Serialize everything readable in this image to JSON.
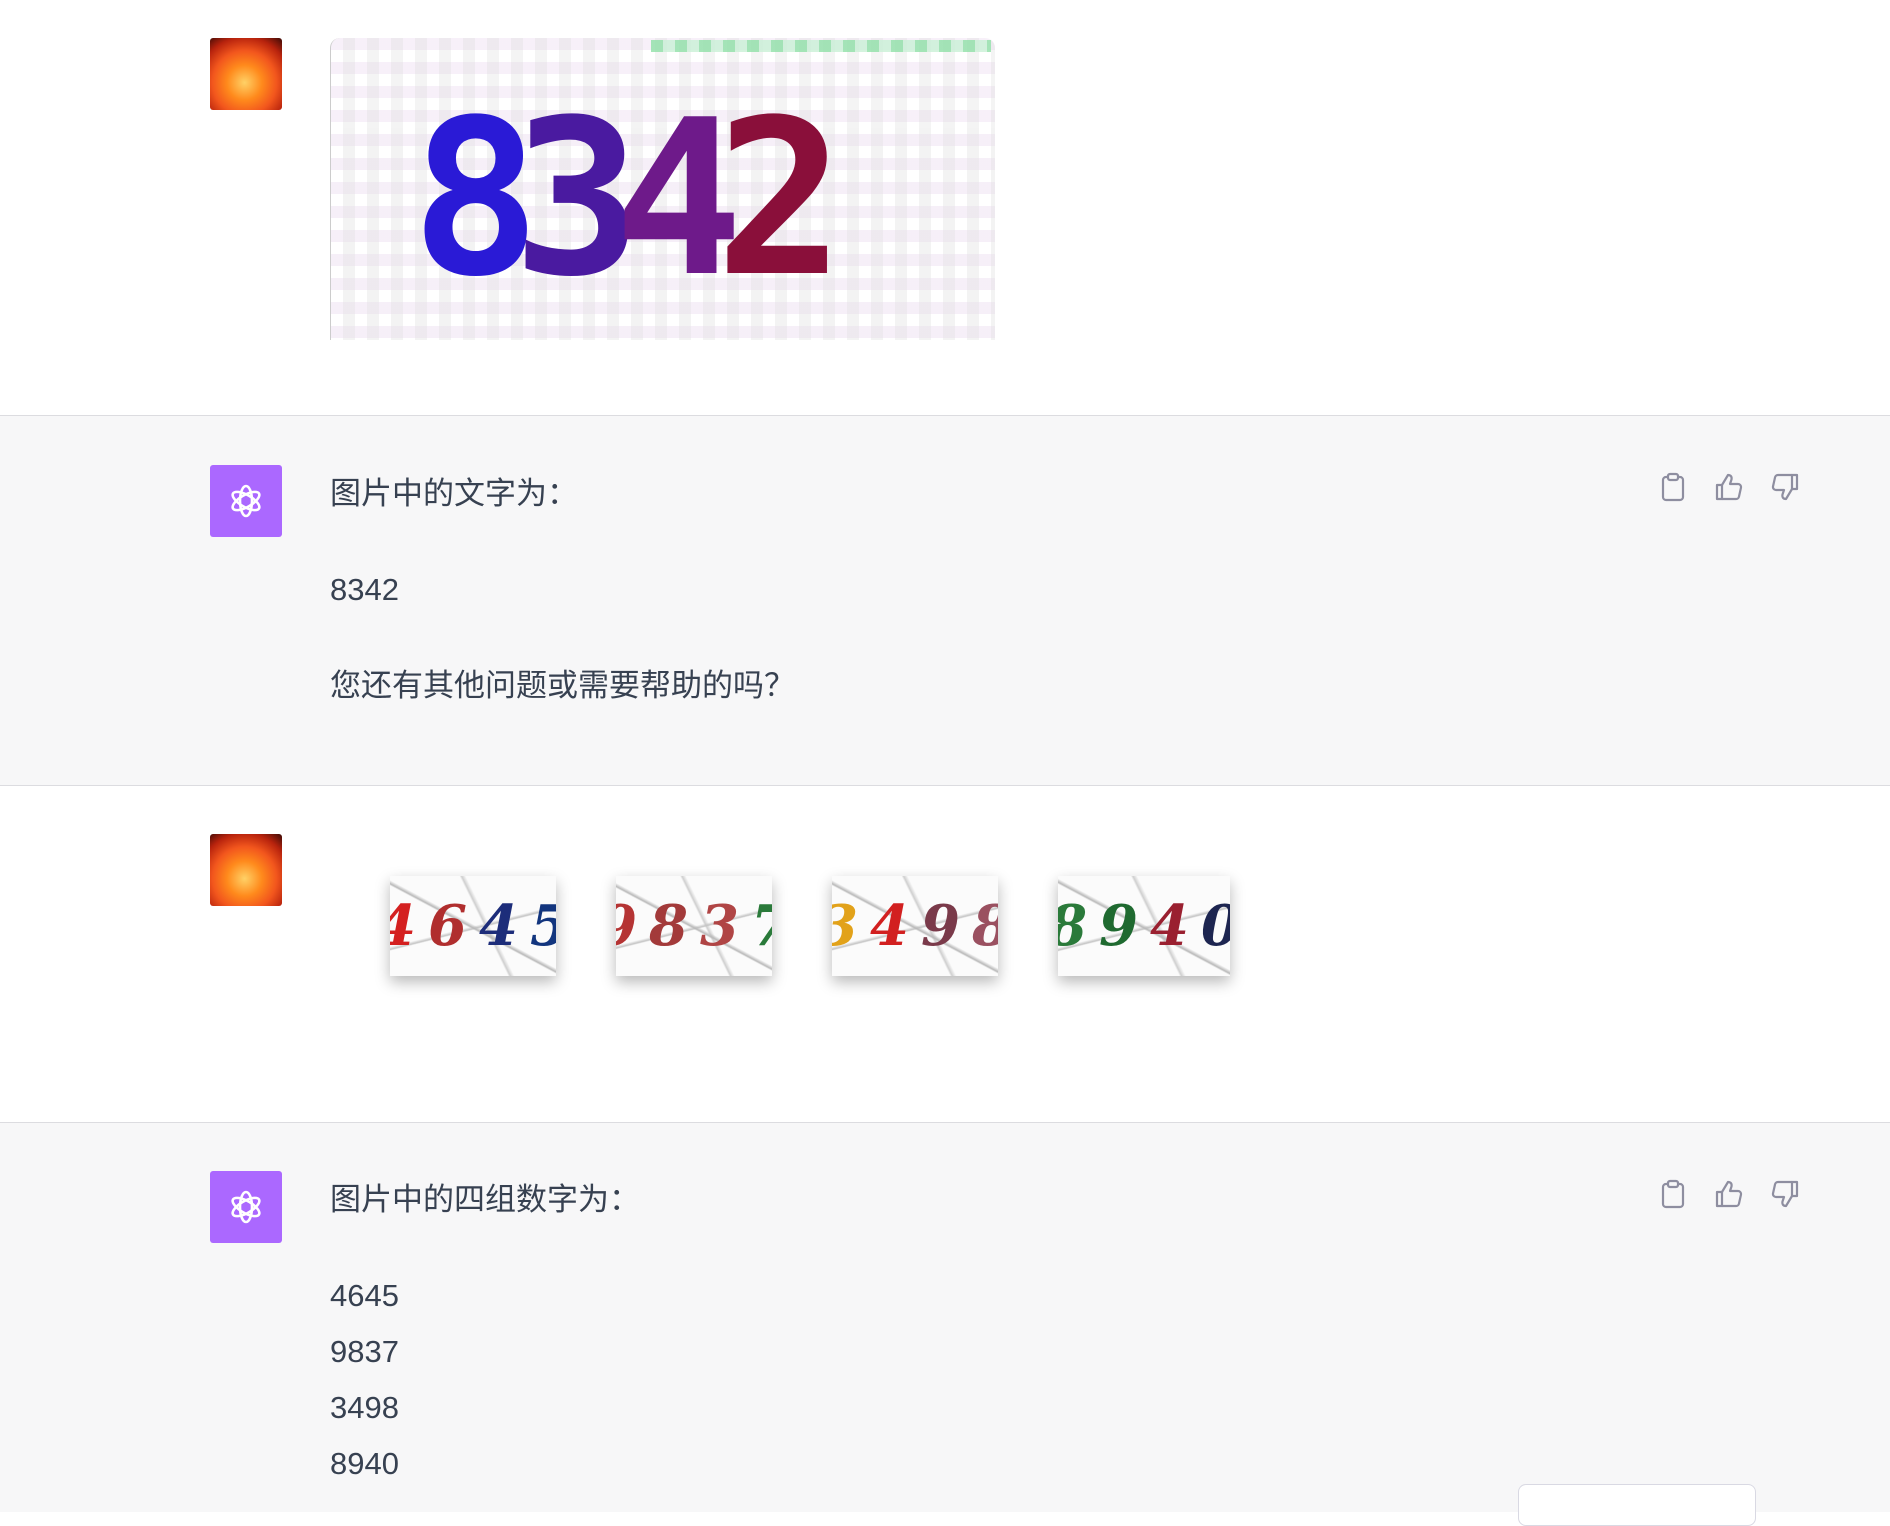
{
  "colors": {
    "assistant_bg": "#f7f7f8",
    "assistant_avatar": "#ab68ff",
    "text": "#374151",
    "icon": "#8e8ea0"
  },
  "messages": [
    {
      "role": "user",
      "avatar_icon": "sun-photo-avatar",
      "image": {
        "type": "captcha",
        "digits": [
          {
            "char": "8",
            "color": "#2a1ad6"
          },
          {
            "char": "3",
            "color": "#4a1aa0"
          },
          {
            "char": "4",
            "color": "#6e1a8a"
          },
          {
            "char": "2",
            "color": "#8a0f3a"
          }
        ]
      }
    },
    {
      "role": "assistant",
      "avatar_icon": "openai-logo-icon",
      "lines": [
        "图片中的文字为：",
        "8342",
        "您还有其他问题或需要帮助的吗？"
      ],
      "actions": [
        "clipboard-icon",
        "thumbs-up-icon",
        "thumbs-down-icon"
      ]
    },
    {
      "role": "user",
      "avatar_icon": "sun-photo-avatar",
      "captchas": [
        {
          "digits": [
            {
              "char": "4",
              "color": "#d42020"
            },
            {
              "char": "6",
              "color": "#b02e2e"
            },
            {
              "char": "4",
              "color": "#1d2d7a"
            },
            {
              "char": "5",
              "color": "#12357e"
            }
          ]
        },
        {
          "digits": [
            {
              "char": "9",
              "color": "#b53434"
            },
            {
              "char": "8",
              "color": "#a33a3a"
            },
            {
              "char": "3",
              "color": "#b04545"
            },
            {
              "char": "7",
              "color": "#2a7a3a"
            }
          ]
        },
        {
          "digits": [
            {
              "char": "3",
              "color": "#e2a21a"
            },
            {
              "char": "4",
              "color": "#d22020"
            },
            {
              "char": "9",
              "color": "#7a3a4a"
            },
            {
              "char": "8",
              "color": "#9a5060"
            }
          ]
        },
        {
          "digits": [
            {
              "char": "8",
              "color": "#2a7a3a"
            },
            {
              "char": "9",
              "color": "#1f6a30"
            },
            {
              "char": "4",
              "color": "#9a2030"
            },
            {
              "char": "0",
              "color": "#1d2550"
            }
          ]
        }
      ]
    },
    {
      "role": "assistant",
      "avatar_icon": "openai-logo-icon",
      "lines": [
        "图片中的四组数字为：",
        "4645",
        "9837",
        "3498",
        "8940"
      ],
      "actions": [
        "clipboard-icon",
        "thumbs-up-icon",
        "thumbs-down-icon"
      ]
    }
  ]
}
